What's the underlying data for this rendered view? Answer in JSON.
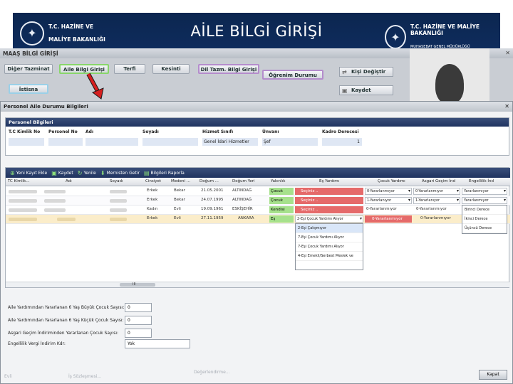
{
  "banner": {
    "title": "AİLE BİLGİ GİRİŞİ",
    "logo_left_line1": "T.C. HAZİNE VE",
    "logo_left_line2": "MALİYE BAKANLIĞI",
    "logo_right_line1": "T.C. HAZİNE VE MALİYE BAKANLIĞI",
    "logo_right_line2": "MUHASEBAT GENEL MÜDÜRLÜĞÜ"
  },
  "app": {
    "title": "MAAŞ BİLGİ GİRİŞİ",
    "buttons": {
      "diger_tazminat": "Diğer Tazminat",
      "aile_bilgi_girisi": "Aile Bilgi Girişi",
      "terfi": "Terfi",
      "kesinti": "Kesinti",
      "dil_tazm": "Dil Tazm. Bilgi Girişi",
      "ogrenim_durumu": "Öğrenim Durumu",
      "istisna": "İstisna",
      "kisi_degistir": "Kişi Değiştir",
      "kaydet": "Kaydet"
    }
  },
  "dialog": {
    "title": "Personel Aile Durumu Bilgileri",
    "personel": {
      "header": "Personel Bilgileri",
      "labels": {
        "tc": "T.C Kimlik No",
        "personel_no": "Personel No",
        "adi": "Adı",
        "soyadi": "Soyadı",
        "hizmet_sinifi": "Hizmet Sınıfı",
        "unvani": "Ünvanı",
        "kadro_derecesi": "Kadro Derecesi"
      },
      "values": {
        "hizmet_sinifi": "Genel İdari Hizmetler",
        "unvani": "Şef",
        "kadro_derecesi": "1"
      }
    },
    "toolbar": {
      "yeni_kayit": "Yeni Kayıt Ekle",
      "kaydet": "Kaydet",
      "yenile": "Yenile",
      "mernisten_getir": "Mernisten Getir",
      "bilgileri_raporla": "Bilgileri Raporla"
    },
    "columns": [
      "TC Kimlik...",
      "Adı",
      "Soyadı",
      "Cinsiyet",
      "Medeni ...",
      "Doğum ...",
      "Doğum Yeri",
      "Yakınlık",
      "Eş Yardımı",
      "Çocuk Yardımı",
      "Asgari Geçim İnd",
      "Engellilik İnd"
    ],
    "rows": [
      {
        "cinsiyet": "Erkek",
        "medeni": "Bekar",
        "dogum": "21.05.2001",
        "dogum_yeri": "ALTINDAĞ",
        "yakinlik": "Çocuk",
        "es": "Seçiniz ..",
        "cocuk": "0-Yararlanmıyor",
        "asgari": "0-Yararlanmıyor",
        "engel": "Yararlanmıyor"
      },
      {
        "cinsiyet": "Erkek",
        "medeni": "Bekar",
        "dogum": "24.07.1995",
        "dogum_yeri": "ALTINDAĞ",
        "yakinlik": "Çocuk",
        "es": "Seçiniz ..",
        "cocuk": "1-Yararlanıyor",
        "asgari": "1-Yararlanıyor",
        "engel": "Yararlanmıyor"
      },
      {
        "cinsiyet": "Kadın",
        "medeni": "Evli",
        "dogum": "19.09.1961",
        "dogum_yeri": "ESKİŞEHİR",
        "yakinlik": "Kendisi",
        "es": "Seçiniz ..",
        "cocuk": "0-Yararlanmıyor",
        "asgari": "0-Yararlanmıyor",
        "engel": "Birinci Derece"
      },
      {
        "cinsiyet": "Erkek",
        "medeni": "Evli",
        "dogum": "27.11.1959",
        "dogum_yeri": "ANKARA",
        "yakinlik": "Eş",
        "es": "2-Eşi Çocuk Yardımı Alıyor",
        "cocuk": "0-Yararlanmıyor",
        "asgari": "0-Yararlanmıyor",
        "engel": "İkinci Derece"
      }
    ],
    "es_dropdown": [
      "2-Eşi Çalışmıyor",
      "7-Eşi Çocuk Yardımı Alıyor",
      "7-Eşi Çocuk Yardımı Alıyor",
      "4-Eşi Emekli/Serbest Meslek ve"
    ],
    "engel_extra": "Üçüncü Derece",
    "scroll_marker": "III",
    "fields": {
      "buyuk_cocuk": {
        "label": "Aile Yardımından Yararlanan 6 Yaş Büyük Çocuk Sayısı:",
        "value": "0"
      },
      "kucuk_cocuk": {
        "label": "Aile Yardımından Yararlanan 6 Yaş Küçük Çocuk Sayısı:",
        "value": "0"
      },
      "asgari_cocuk": {
        "label": "Asgari Geçim İndiriminden Yararlanan Çocuk Sayısı:",
        "value": "0"
      },
      "engellilik": {
        "label": "Engellilik Vergi İndirim Kdr:",
        "value": "Yok"
      }
    },
    "close_button": "Kapat",
    "ghost_left": "Evli",
    "ghost_mid": "İş Sözleşmesi...",
    "ghost_right": "Değerlendirme..."
  },
  "colors": {
    "banner": "#0e2c5c",
    "highlight_green": "#88d66a",
    "highlight_purple": "#b48ccc",
    "red_arrow": "#d61f1f",
    "yes_cell": "#a6e18c",
    "red_cell": "#e56a6a"
  }
}
